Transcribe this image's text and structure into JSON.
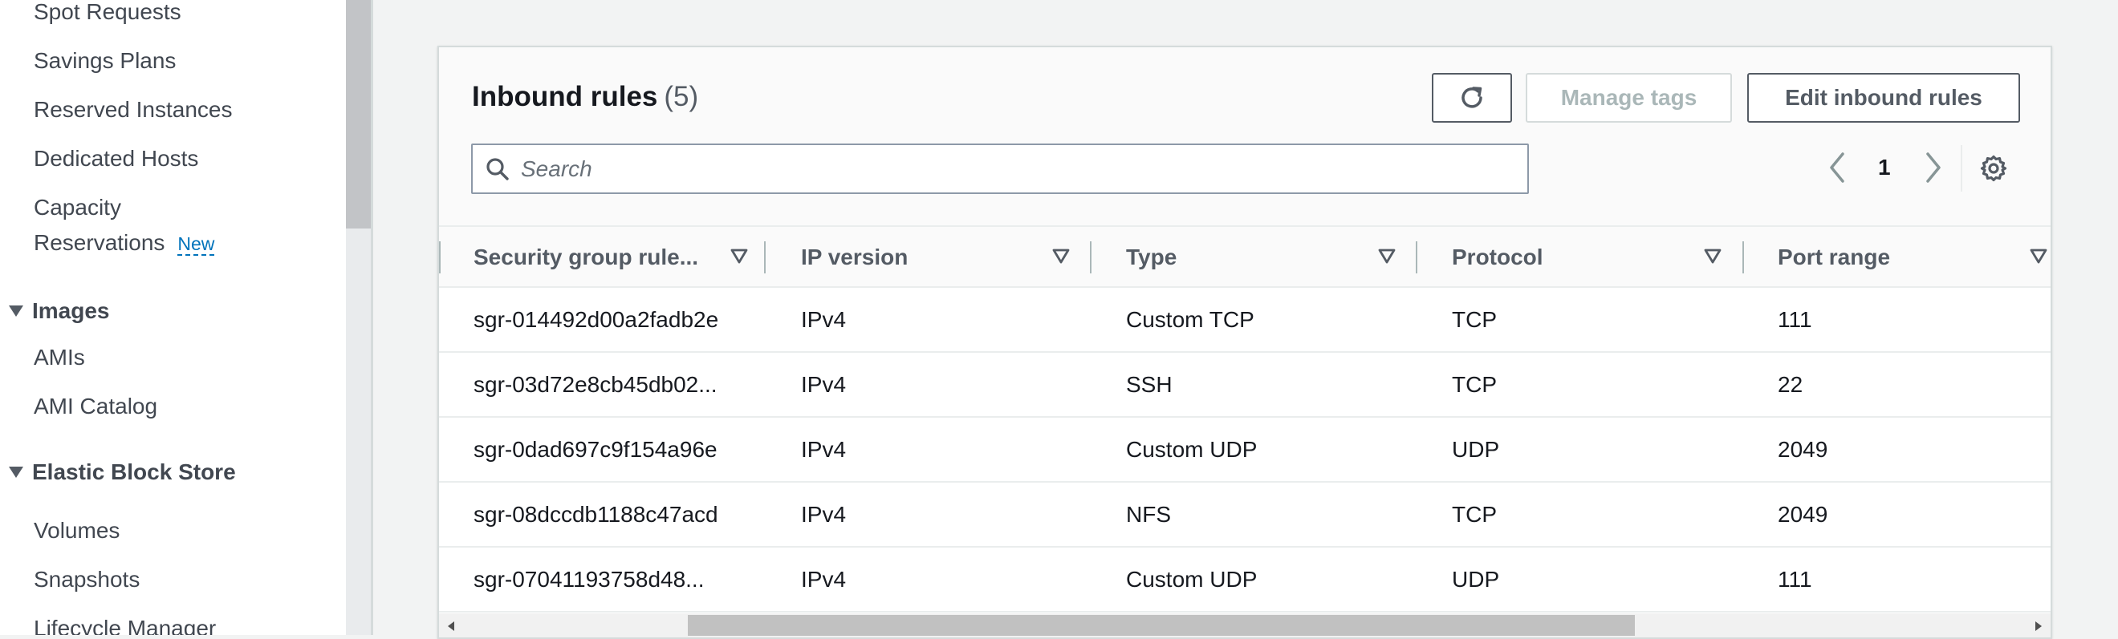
{
  "sidebar": {
    "items_top": [
      "Spot Requests",
      "Savings Plans",
      "Reserved Instances",
      "Dedicated Hosts"
    ],
    "capacity": {
      "line1": "Capacity",
      "line2": "Reservations",
      "badge": "New"
    },
    "sections": [
      {
        "title": "Images",
        "items": [
          "AMIs",
          "AMI Catalog"
        ]
      },
      {
        "title": "Elastic Block Store",
        "items": [
          "Volumes",
          "Snapshots",
          "Lifecycle Manager"
        ]
      }
    ]
  },
  "panel": {
    "title": "Inbound rules",
    "count": "(5)",
    "buttons": {
      "refresh_icon": "refresh-icon",
      "manage_tags": "Manage tags",
      "edit_inbound": "Edit inbound rules"
    },
    "search": {
      "placeholder": "Search",
      "value": ""
    },
    "pagination": {
      "current_page": "1"
    },
    "settings_icon": "gear-icon"
  },
  "table": {
    "columns": [
      "Security group rule...",
      "IP version",
      "Type",
      "Protocol",
      "Port range"
    ],
    "rows": [
      [
        "sgr-014492d00a2fadb2e",
        "IPv4",
        "Custom TCP",
        "TCP",
        "111"
      ],
      [
        "sgr-03d72e8cb45db02...",
        "IPv4",
        "SSH",
        "TCP",
        "22"
      ],
      [
        "sgr-0dad697c9f154a96e",
        "IPv4",
        "Custom UDP",
        "UDP",
        "2049"
      ],
      [
        "sgr-08dccdb1188c47acd",
        "IPv4",
        "NFS",
        "TCP",
        "2049"
      ],
      [
        "sgr-07041193758d48...",
        "IPv4",
        "Custom UDP",
        "UDP",
        "111"
      ]
    ]
  },
  "colors": {
    "accent_link": "#0073bb",
    "text_primary": "#16191f",
    "text_secondary": "#545b64",
    "disabled": "#aab7b8",
    "background": "#f2f3f3"
  }
}
